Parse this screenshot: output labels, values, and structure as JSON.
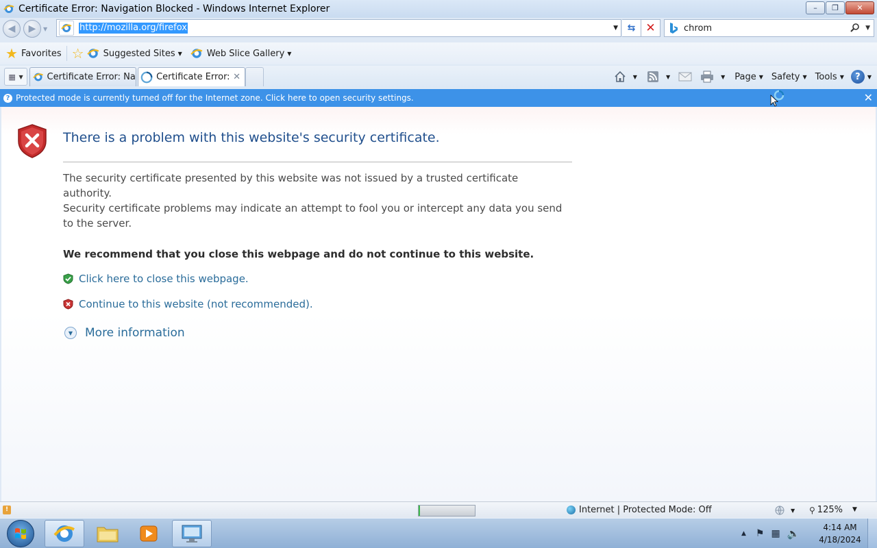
{
  "window": {
    "title": "Certificate Error: Navigation Blocked - Windows Internet Explorer",
    "minimize_glyph": "–",
    "restore_glyph": "❐",
    "close_glyph": "✕"
  },
  "address_bar": {
    "url": "http://mozilla.org/firefox",
    "refresh_glyph": "⇆",
    "stop_glyph": "✕"
  },
  "search": {
    "value": "chrom",
    "provider_icon": "bing-icon"
  },
  "favorites_bar": {
    "favorites_label": "Favorites",
    "suggested_sites_label": "Suggested Sites",
    "web_slice_gallery_label": "Web Slice Gallery"
  },
  "tabs": [
    {
      "label": "Certificate Error: Na..."
    },
    {
      "label": "Certificate Error: ...",
      "close_glyph": "✕"
    }
  ],
  "command_bar": {
    "page_label": "Page",
    "safety_label": "Safety",
    "tools_label": "Tools",
    "help_glyph": "?"
  },
  "info_bar": {
    "message": "Protected mode is currently turned off for the Internet zone.  Click here to open security settings.",
    "close_glyph": "✕"
  },
  "error_page": {
    "title": "There is a problem with this website's security certificate.",
    "para_1": "The security certificate presented by this website was not issued by a trusted certificate authority.",
    "para_2": "Security certificate problems may indicate an attempt to fool you or intercept any data you send to the server.",
    "recommendation": "We recommend that you close this webpage and do not continue to this website.",
    "close_link": "Click here to close this webpage.",
    "continue_link": "Continue to this website (not recommended).",
    "more_info": "More information"
  },
  "status_bar": {
    "progress": 0.02,
    "zone": "Internet | Protected Mode: Off",
    "zoom": "125%"
  },
  "taskbar": {
    "time": "4:14 AM",
    "date": "4/18/2024"
  },
  "colors": {
    "info_bar": "#3d92e8",
    "link": "#2a6c9a",
    "title": "#1f4e8c",
    "selection": "#3399ff"
  }
}
